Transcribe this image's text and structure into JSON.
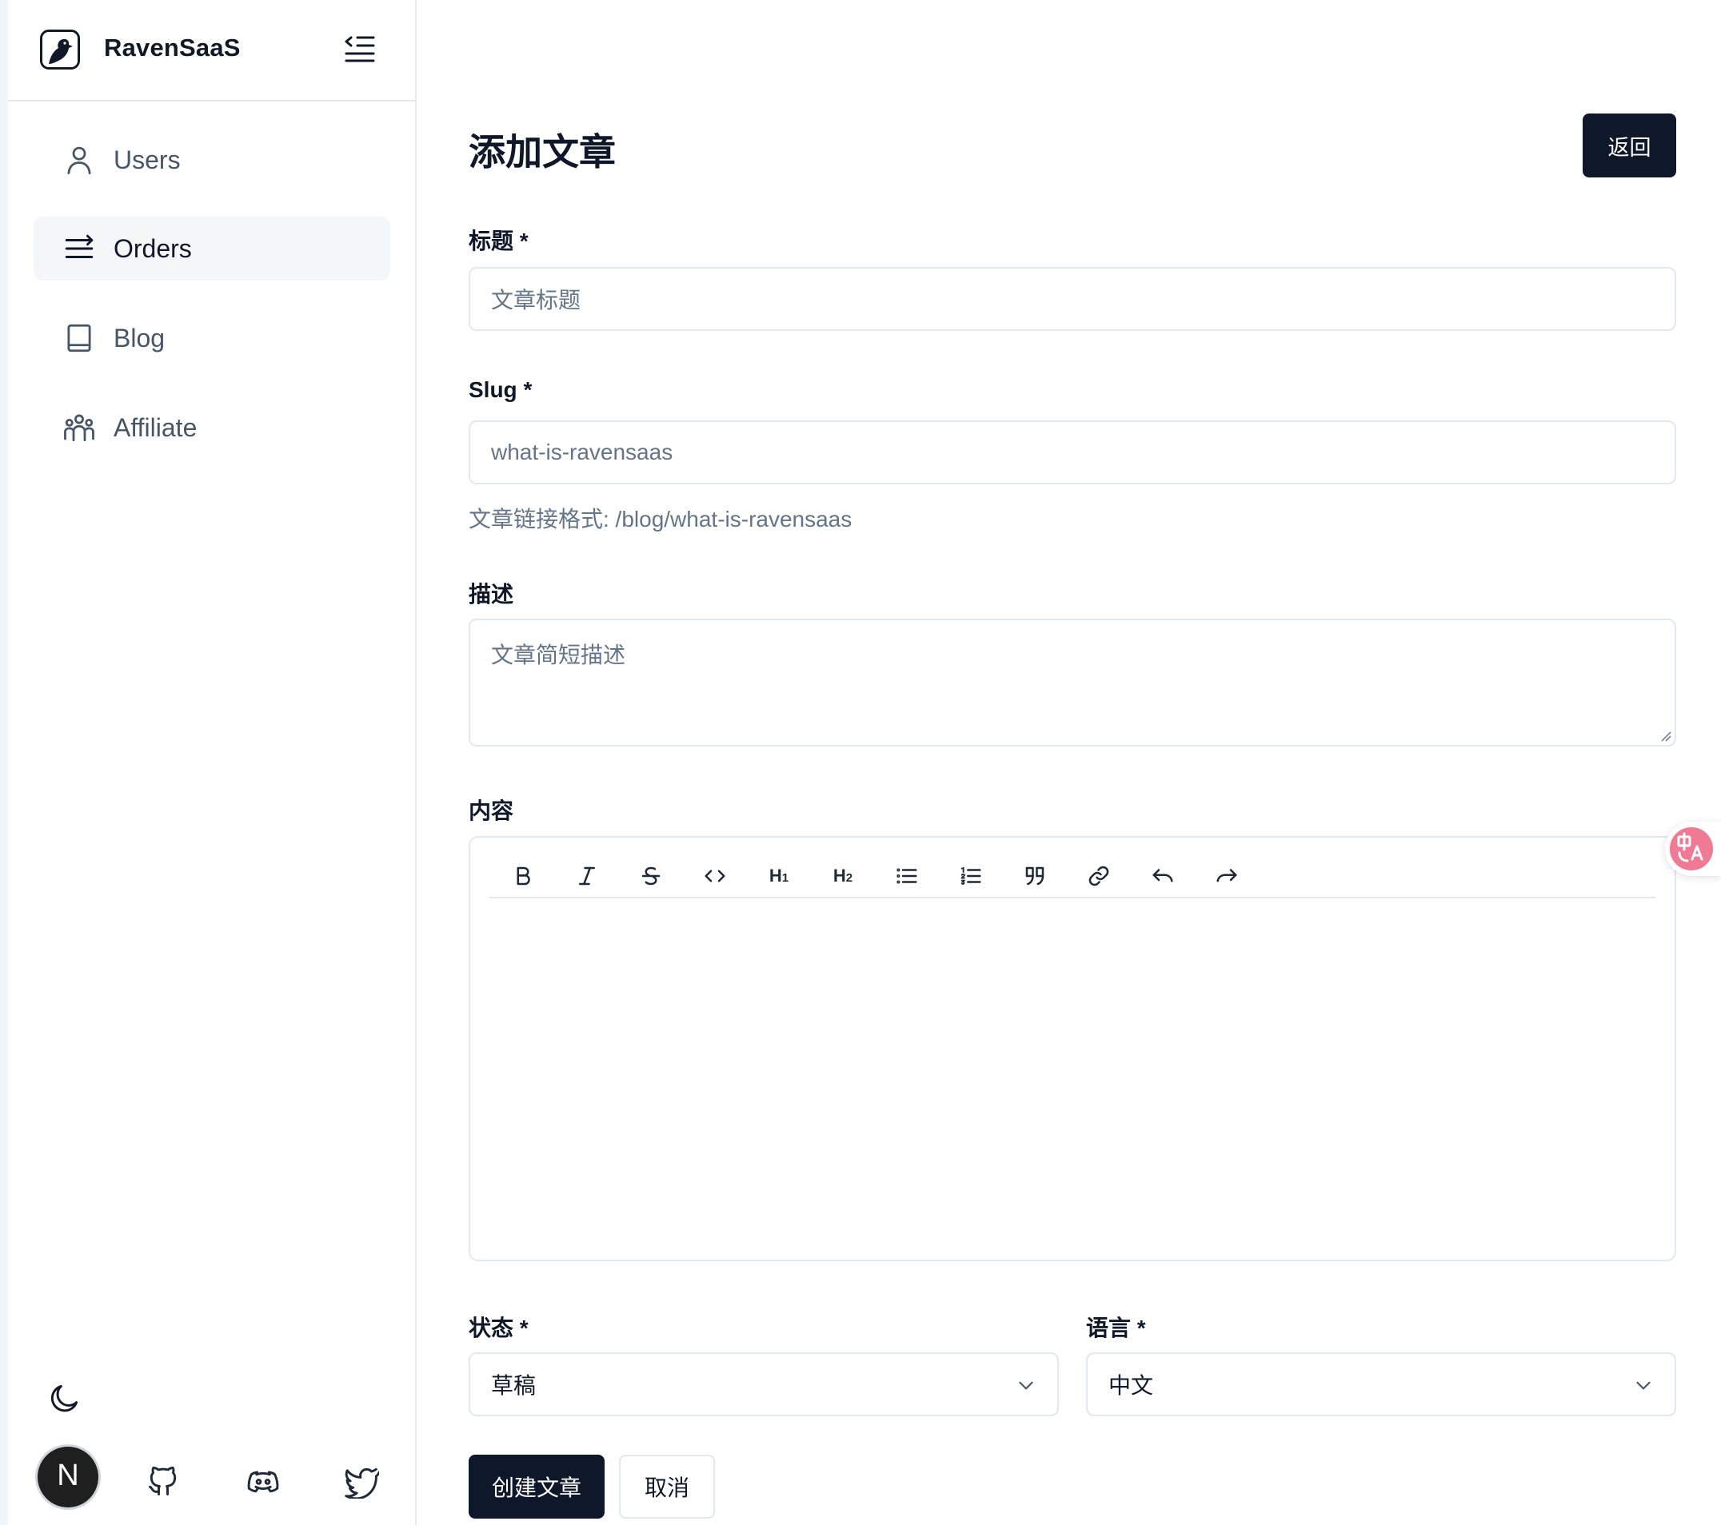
{
  "app": {
    "name": "RavenSaaS"
  },
  "sidebar": {
    "items": [
      {
        "label": "Users",
        "icon": "user-icon",
        "active": false
      },
      {
        "label": "Orders",
        "icon": "orders-list-icon",
        "active": true
      },
      {
        "label": "Blog",
        "icon": "book-icon",
        "active": false
      },
      {
        "label": "Affiliate",
        "icon": "people-group-icon",
        "active": false
      }
    ],
    "footer": {
      "avatar_letter": "N",
      "icons": [
        "moon-icon",
        "github-icon",
        "discord-icon",
        "twitter-icon"
      ]
    }
  },
  "page": {
    "title": "添加文章",
    "back_label": "返回"
  },
  "form": {
    "title": {
      "label": "标题 *",
      "placeholder": "文章标题"
    },
    "slug": {
      "label": "Slug *",
      "placeholder": "what-is-ravensaas",
      "help": "文章链接格式: /blog/what-is-ravensaas"
    },
    "description": {
      "label": "描述",
      "placeholder": "文章简短描述"
    },
    "content": {
      "label": "内容",
      "toolbar": [
        "bold",
        "italic",
        "strikethrough",
        "code",
        "heading-1",
        "heading-2",
        "bullet-list",
        "ordered-list",
        "blockquote",
        "link",
        "undo",
        "redo"
      ]
    },
    "status": {
      "label": "状态 *",
      "value": "草稿"
    },
    "language": {
      "label": "语言 *",
      "value": "中文"
    },
    "submit_label": "创建文章",
    "cancel_label": "取消"
  },
  "colors": {
    "primary": "#0f172a",
    "border": "#e2e8f0",
    "muted_text": "#64748b",
    "active_nav_bg": "#f5f6f7",
    "translate_fab": "#f07a93"
  }
}
